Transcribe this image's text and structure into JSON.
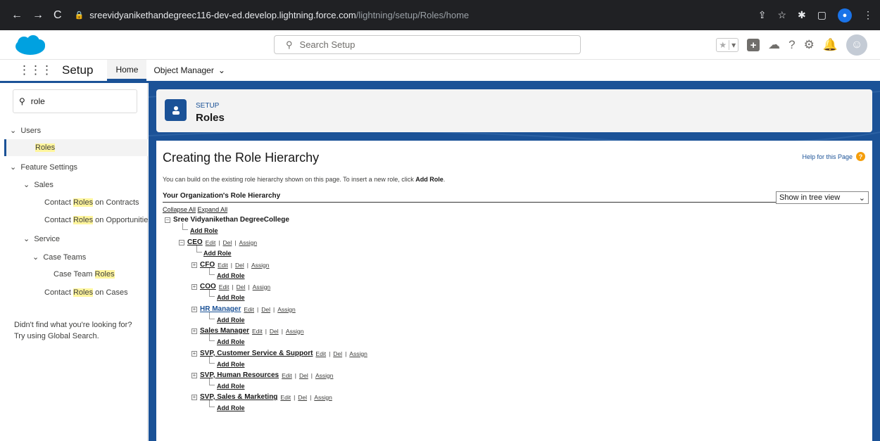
{
  "browser": {
    "url_host": "sreevidyanikethandegreec116-dev-ed.develop.lightning.force.com",
    "url_path": "/lightning/setup/Roles/home"
  },
  "header": {
    "search_placeholder": "Search Setup"
  },
  "tabs": {
    "app_name": "Setup",
    "home": "Home",
    "object_manager": "Object Manager"
  },
  "leftnav": {
    "quick_find_value": "role",
    "users": "Users",
    "roles": "Roles",
    "feature_settings": "Feature Settings",
    "sales": "Sales",
    "contact_roles_contracts_a": "Contact ",
    "contact_roles_contracts_b": "Roles",
    "contact_roles_contracts_c": " on Contracts",
    "contact_roles_opps_a": "Contact ",
    "contact_roles_opps_b": "Roles",
    "contact_roles_opps_c": " on Opportunities",
    "service": "Service",
    "case_teams": "Case Teams",
    "case_team_roles_a": "Case Team ",
    "case_team_roles_b": "Roles",
    "contact_roles_cases_a": "Contact ",
    "contact_roles_cases_b": "Roles",
    "contact_roles_cases_c": " on Cases",
    "not_found_line1": "Didn't find what you're looking for?",
    "not_found_line2": "Try using Global Search."
  },
  "page_header": {
    "eyebrow": "SETUP",
    "title": "Roles"
  },
  "content": {
    "title": "Creating the Role Hierarchy",
    "help": "Help for this Page",
    "intro": "You can build on the existing role hierarchy shown on this page. To insert a new role, click ",
    "intro_bold": "Add Role",
    "intro_end": ".",
    "section": "Your Organization's Role Hierarchy",
    "view_select": "Show in tree view",
    "collapse_all": "Collapse All",
    "expand_all": "Expand All",
    "root": "Sree Vidyanikethan DegreeCollege",
    "add_role": "Add Role",
    "edit": "Edit",
    "del": "Del",
    "assign": "Assign",
    "pipe": "|",
    "ceo": "CEO",
    "children": [
      "CFO",
      "COO",
      "HR Manager",
      "Sales Manager",
      "SVP, Customer Service & Support",
      "SVP, Human Resources",
      "SVP, Sales & Marketing"
    ]
  }
}
